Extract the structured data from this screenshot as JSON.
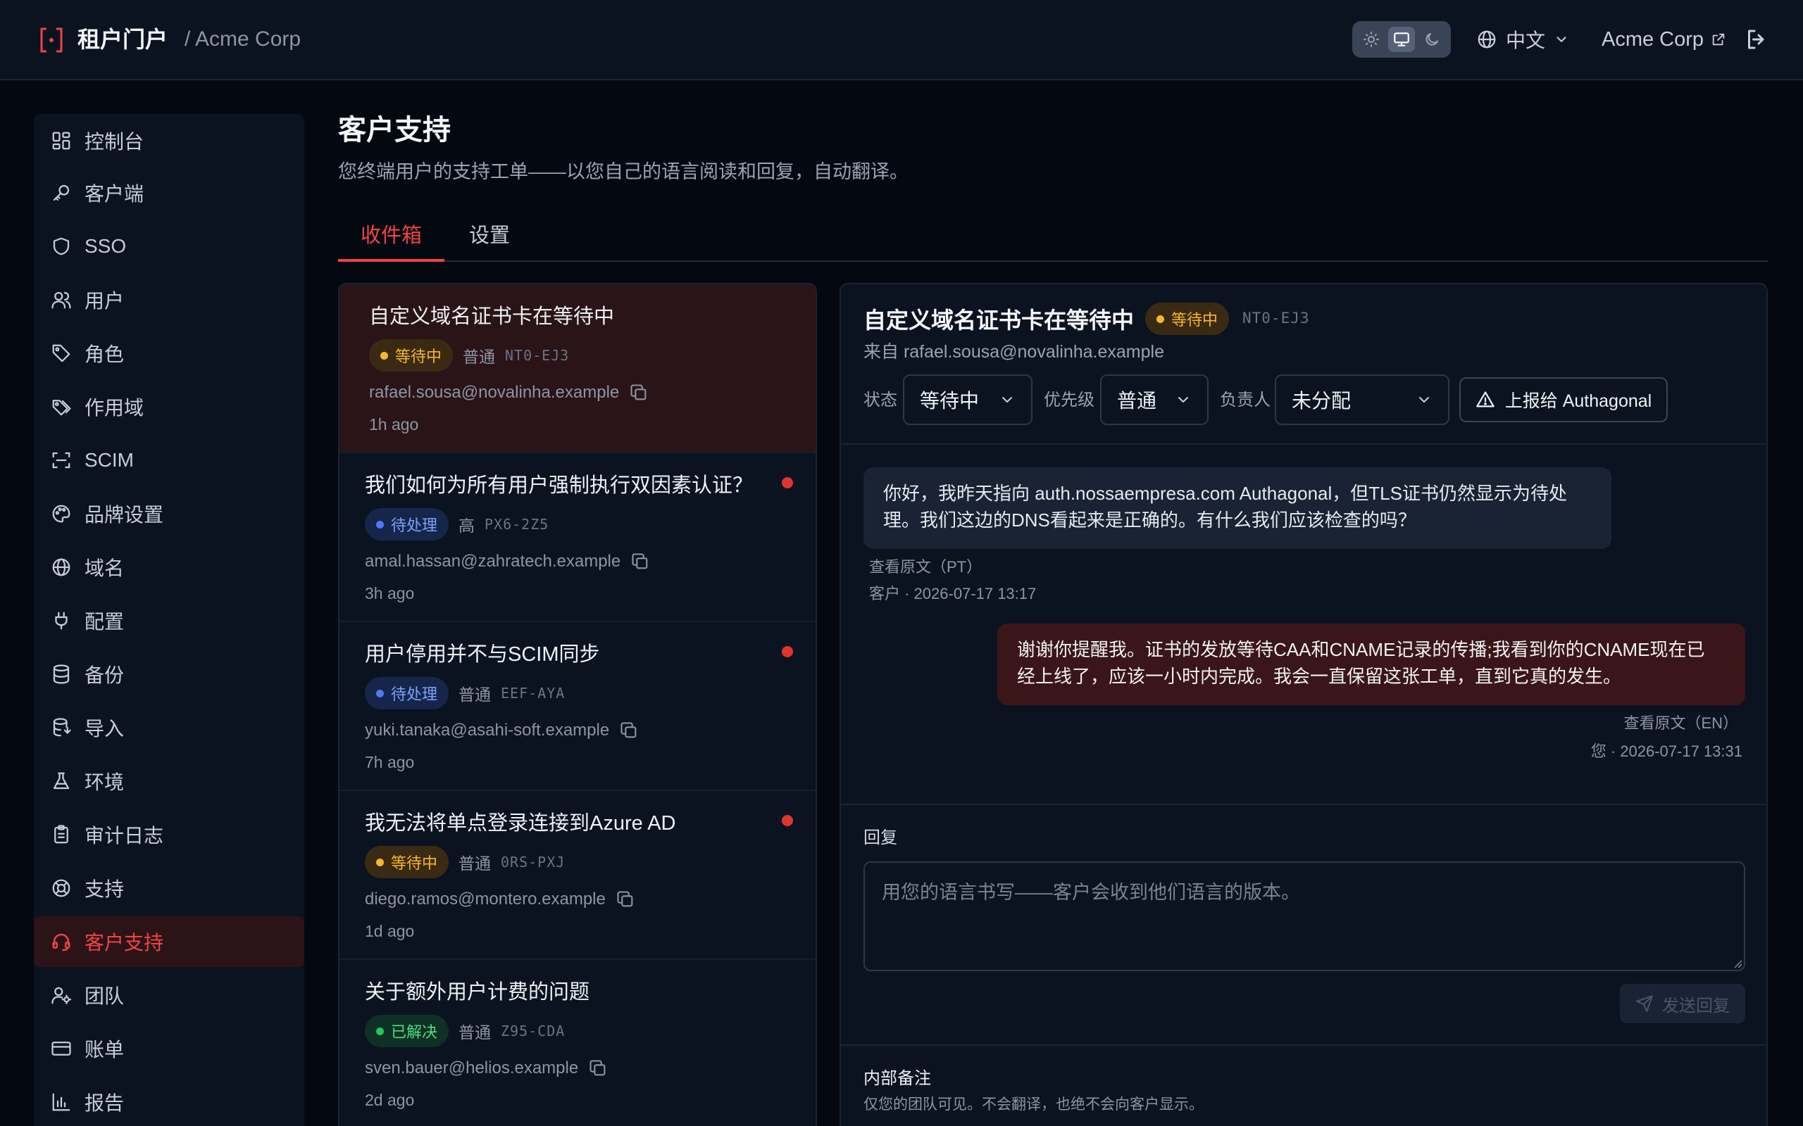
{
  "header": {
    "app_title": "租户门户",
    "org_crumb": "/ Acme Corp",
    "theme_options": [
      "light",
      "system",
      "dark"
    ],
    "theme_selected": "system",
    "language": "中文",
    "tenant_name": "Acme Corp"
  },
  "sidebar": {
    "items": [
      {
        "label": "控制台",
        "icon": "dashboard-icon"
      },
      {
        "label": "客户端",
        "icon": "key-icon"
      },
      {
        "label": "SSO",
        "icon": "shield-icon"
      },
      {
        "label": "用户",
        "icon": "users-icon"
      },
      {
        "label": "角色",
        "icon": "tag-icon"
      },
      {
        "label": "作用域",
        "icon": "tags-icon"
      },
      {
        "label": "SCIM",
        "icon": "scan-icon"
      },
      {
        "label": "品牌设置",
        "icon": "palette-icon"
      },
      {
        "label": "域名",
        "icon": "globe-icon"
      },
      {
        "label": "配置",
        "icon": "plug-icon"
      },
      {
        "label": "备份",
        "icon": "database-icon"
      },
      {
        "label": "导入",
        "icon": "database-import-icon"
      },
      {
        "label": "环境",
        "icon": "flask-icon"
      },
      {
        "label": "审计日志",
        "icon": "clipboard-icon"
      },
      {
        "label": "支持",
        "icon": "lifebuoy-icon"
      },
      {
        "label": "客户支持",
        "icon": "headset-icon",
        "active": true
      },
      {
        "label": "团队",
        "icon": "user-cog-icon"
      },
      {
        "label": "账单",
        "icon": "credit-card-icon"
      },
      {
        "label": "报告",
        "icon": "bar-chart-icon"
      }
    ]
  },
  "page": {
    "title": "客户支持",
    "subtitle": "您终端用户的支持工单——以您自己的语言阅读和回复，自动翻译。",
    "tabs": [
      "收件箱",
      "设置"
    ],
    "active_tab": "收件箱"
  },
  "tickets": [
    {
      "subject": "自定义域名证书卡在等待中",
      "status": "等待中",
      "status_kind": "waiting",
      "priority": "普通",
      "id": "NT0-EJ3",
      "email": "rafael.sousa@novalinha.example",
      "time": "1h ago",
      "unread": false,
      "selected": true
    },
    {
      "subject": "我们如何为所有用户强制执行双因素认证？",
      "status": "待处理",
      "status_kind": "pending",
      "priority": "高",
      "id": "PX6-2Z5",
      "email": "amal.hassan@zahratech.example",
      "time": "3h ago",
      "unread": true,
      "selected": false
    },
    {
      "subject": "用户停用并不与SCIM同步",
      "status": "待处理",
      "status_kind": "pending",
      "priority": "普通",
      "id": "EEF-AYA",
      "email": "yuki.tanaka@asahi-soft.example",
      "time": "7h ago",
      "unread": true,
      "selected": false
    },
    {
      "subject": "我无法将单点登录连接到Azure AD",
      "status": "等待中",
      "status_kind": "waiting",
      "priority": "普通",
      "id": "0RS-PXJ",
      "email": "diego.ramos@montero.example",
      "time": "1d ago",
      "unread": true,
      "selected": false
    },
    {
      "subject": "关于额外用户计费的问题",
      "status": "已解决",
      "status_kind": "resolved",
      "priority": "普通",
      "id": "Z95-CDA",
      "email": "sven.bauer@helios.example",
      "time": "2d ago",
      "unread": false,
      "selected": false
    }
  ],
  "detail": {
    "title": "自定义域名证书卡在等待中",
    "status": "等待中",
    "id": "NT0-EJ3",
    "from": "来自 rafael.sousa@novalinha.example",
    "status_label": "状态",
    "status_value": "等待中",
    "priority_label": "优先级",
    "priority_value": "普通",
    "assignee_label": "负责人",
    "assignee_value": "未分配",
    "escalate_label": "上报给 Authagonal",
    "messages": [
      {
        "direction": "in",
        "line1": "你好，我昨天指向 auth.nossaempresa.com Authagonal，但TLS证书仍然显示为待处",
        "line2": "理。我们这边的DNS看起来是正确的。有什么我们应该检查的吗？",
        "original_link": "查看原文（PT）",
        "meta": "客户 · 2026-07-17 13:17"
      },
      {
        "direction": "out",
        "line1": "谢谢你提醒我。证书的发放等待CAA和CNAME记录的传播;我看到你的CNAME现在已",
        "line2": "经上线了，应该一小时内完成。我会一直保留这张工单，直到它真的发生。",
        "original_link": "查看原文（EN）",
        "meta": "您 · 2026-07-17 13:31"
      }
    ],
    "reply_label": "回复",
    "reply_placeholder": "用您的语言书写——客户会收到他们语言的版本。",
    "reply_value": "",
    "send_label": "发送回复",
    "notes_title": "内部备注",
    "notes_subtitle": "仅您的团队可见。不会翻译，也绝不会向客户显示。"
  },
  "colors": {
    "accent": "#ef4444",
    "background": "#040811",
    "panel": "#0b1220",
    "waiting": "#f5b829",
    "pending": "#4b7bf5",
    "resolved": "#22c55e"
  }
}
